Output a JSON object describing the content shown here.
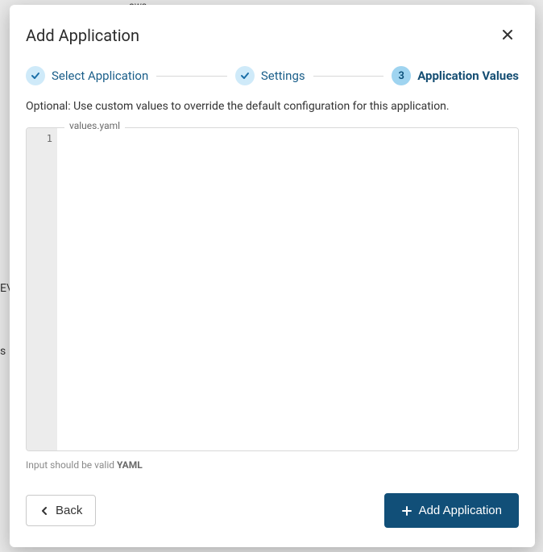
{
  "background": {
    "top_fragment": "ows",
    "left_fragment_1": "E\\",
    "left_fragment_2": "s"
  },
  "modal": {
    "title": "Add Application"
  },
  "stepper": {
    "steps": [
      {
        "label": "Select Application",
        "state": "done"
      },
      {
        "label": "Settings",
        "state": "done"
      },
      {
        "label": "Application Values",
        "state": "active",
        "number": "3"
      }
    ]
  },
  "body": {
    "hint": "Optional: Use custom values to override the default configuration for this application.",
    "editor_label": "values.yaml",
    "editor_line_number": "1",
    "editor_value": "",
    "sub_hint_prefix": "Input should be valid ",
    "sub_hint_strong": "YAML"
  },
  "footer": {
    "back_label": "Back",
    "submit_label": "Add Application"
  }
}
